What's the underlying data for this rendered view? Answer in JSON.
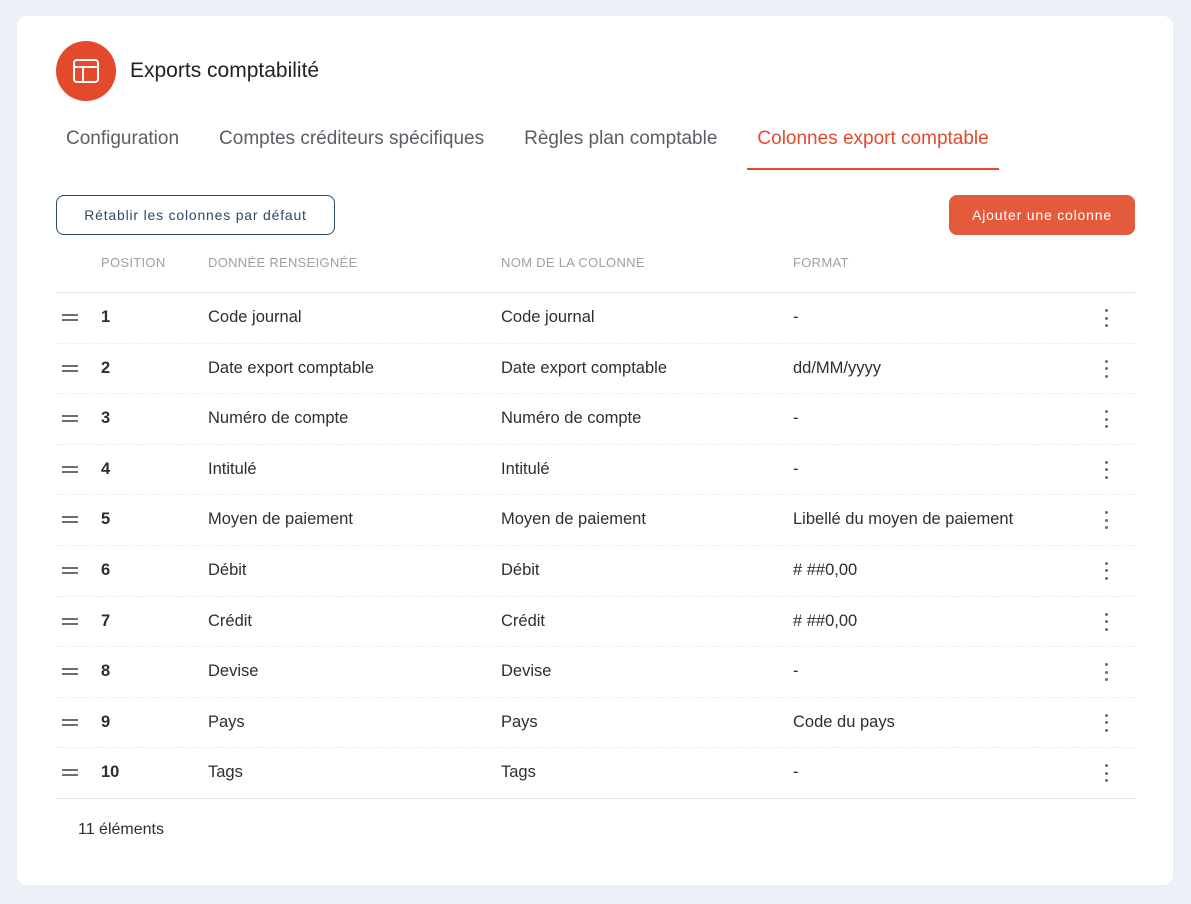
{
  "header": {
    "title": "Exports comptabilité",
    "icon": "layout-icon",
    "accent": "#e24a2b"
  },
  "tabs": [
    {
      "label": "Configuration",
      "active": false
    },
    {
      "label": "Comptes créditeurs spécifiques",
      "active": false
    },
    {
      "label": "Règles plan comptable",
      "active": false
    },
    {
      "label": "Colonnes export comptable",
      "active": true
    }
  ],
  "actions": {
    "reset_label": "Rétablir les colonnes par défaut",
    "add_label": "Ajouter une colonne"
  },
  "table": {
    "headers": {
      "position": "POSITION",
      "donnee": "DONNÉE RENSEIGNÉE",
      "nom": "NOM DE LA COLONNE",
      "format": "FORMAT"
    },
    "rows": [
      {
        "position": "1",
        "donnee": "Code journal",
        "nom": "Code journal",
        "format": "-"
      },
      {
        "position": "2",
        "donnee": "Date export comptable",
        "nom": "Date export comptable",
        "format": "dd/MM/yyyy"
      },
      {
        "position": "3",
        "donnee": "Numéro de compte",
        "nom": "Numéro de compte",
        "format": "-"
      },
      {
        "position": "4",
        "donnee": "Intitulé",
        "nom": "Intitulé",
        "format": "-"
      },
      {
        "position": "5",
        "donnee": "Moyen de paiement",
        "nom": "Moyen de paiement",
        "format": "Libellé du moyen de paiement"
      },
      {
        "position": "6",
        "donnee": "Débit",
        "nom": "Débit",
        "format": "# ##0,00"
      },
      {
        "position": "7",
        "donnee": "Crédit",
        "nom": "Crédit",
        "format": "# ##0,00"
      },
      {
        "position": "8",
        "donnee": "Devise",
        "nom": "Devise",
        "format": "-"
      },
      {
        "position": "9",
        "donnee": "Pays",
        "nom": "Pays",
        "format": "Code du pays"
      },
      {
        "position": "10",
        "donnee": "Tags",
        "nom": "Tags",
        "format": "-"
      }
    ]
  },
  "footer": {
    "count_label": "11 éléments"
  }
}
